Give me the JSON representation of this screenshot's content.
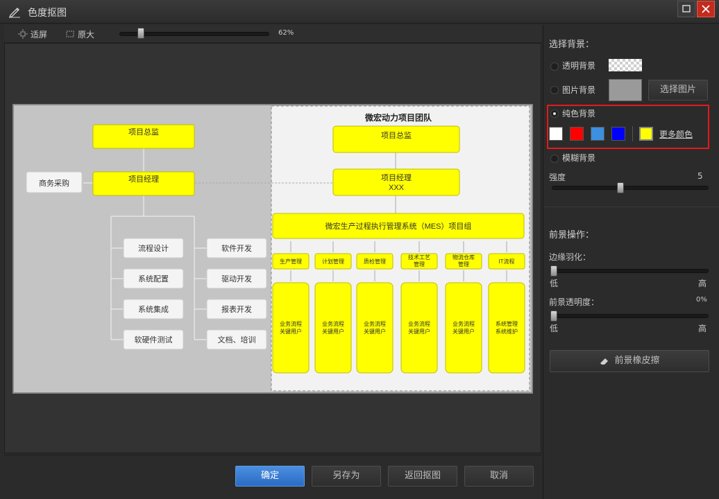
{
  "window": {
    "title": "色度抠图",
    "maximize_icon": "maximize-icon",
    "close_icon": "close-icon"
  },
  "toolbar": {
    "fit_label": "适屏",
    "original_label": "原大",
    "zoom_percent": "62%",
    "zoom_value": 62
  },
  "bottom": {
    "confirm": "确定",
    "save_as": "另存为",
    "back": "返回抠图",
    "cancel": "取消"
  },
  "right": {
    "select_bg_title": "选择背景：",
    "transparent_bg": "透明背景",
    "image_bg": "图片背景",
    "choose_image": "选择图片",
    "solid_bg": "纯色背景",
    "more_colors": "更多颜色",
    "blur_bg": "模糊背景",
    "strength_label": "强度",
    "strength_value": "5",
    "foreground_title": "前景操作：",
    "feather_label": "边缘羽化：",
    "low": "低",
    "high": "高",
    "opacity_label": "前景透明度：",
    "opacity_value": "0%",
    "eraser_button": "前景橡皮擦",
    "selected_background": "solid",
    "colors": {
      "white": "#ffffff",
      "red": "#ff0000",
      "light_blue": "#3d8fe0",
      "blue": "#0000ff",
      "yellow": "#ffff00",
      "highlight": "#e51a1a"
    }
  },
  "chart": {
    "left": {
      "director": "项目总监",
      "manager": "项目经理",
      "purchasing": "商务采购",
      "flow_design": "流程设计",
      "system_config": "系统配置",
      "system_integration": "系统集成",
      "hw_sw_test": "软硬件测试",
      "software_dev": "软件开发",
      "driver_dev": "驱动开发",
      "report_dev": "报表开发",
      "docs_training": "文档、培训"
    },
    "right": {
      "team_title": "微宏动力项目团队",
      "director": "项目总监",
      "manager_line1": "项目经理",
      "manager_line2": "XXX",
      "mes_group": "微宏生产过程执行管理系统（MES）项目组",
      "depts": [
        {
          "top1": "生产管理",
          "top2": "",
          "bot1": "业务流程",
          "bot2": "关键用户"
        },
        {
          "top1": "计划管理",
          "top2": "",
          "bot1": "业务流程",
          "bot2": "关键用户"
        },
        {
          "top1": "质检管理",
          "top2": "",
          "bot1": "业务流程",
          "bot2": "关键用户"
        },
        {
          "top1": "技术工艺",
          "top2": "管理",
          "bot1": "业务流程",
          "bot2": "关键用户"
        },
        {
          "top1": "物流仓库",
          "top2": "管理",
          "bot1": "业务流程",
          "bot2": "关键用户"
        },
        {
          "top1": "IT流程",
          "top2": "",
          "bot1": "系统管理",
          "bot2": "系统维护"
        }
      ]
    }
  }
}
